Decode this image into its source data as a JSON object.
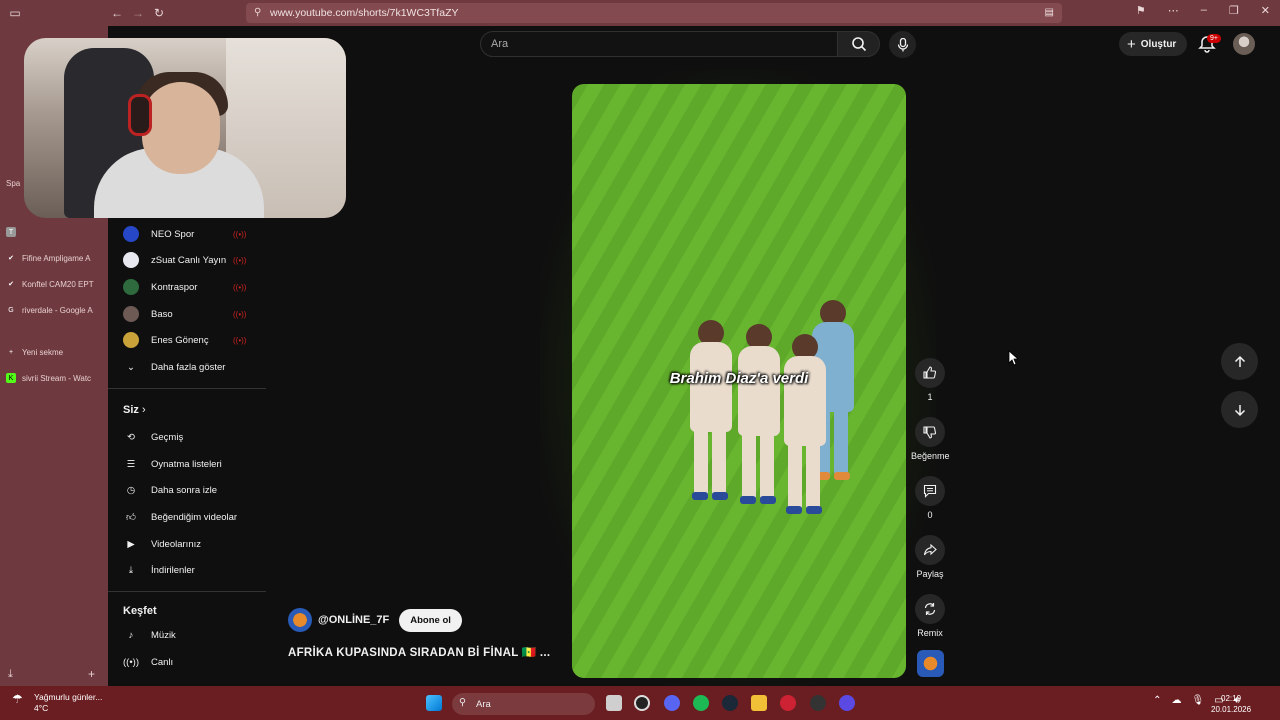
{
  "browser": {
    "url": "www.youtube.com/shorts/7k1WC3TfaZY",
    "tabs": [
      {
        "label": "Fifine Ampligame A",
        "icon": "check-icon"
      },
      {
        "label": "Konftel CAM20 EPT",
        "icon": "check-icon"
      },
      {
        "label": "riverdale - Google A",
        "icon": "google-icon"
      },
      {
        "label": "Yeni sekme",
        "icon": "plus-icon"
      },
      {
        "label": "sivrii Stream - Watc",
        "icon": "kick-icon"
      }
    ],
    "space_label": "Spa"
  },
  "header": {
    "search_placeholder": "Ara",
    "create_label": "Oluştur",
    "notification_count": "9+"
  },
  "sidebar": {
    "subscriptions": [
      {
        "label": "NEO Spor",
        "color": "#2747c9"
      },
      {
        "label": "zSuat Canlı Yayın",
        "color": "#e8e8f0"
      },
      {
        "label": "Kontraspor",
        "color": "#2e6a3e"
      },
      {
        "label": "Baso",
        "color": "#6d5a55"
      },
      {
        "label": "Enes Gönenç",
        "color": "#c9a23a"
      }
    ],
    "show_more": "Daha fazla göster",
    "you_heading": "Siz",
    "you_items": [
      {
        "label": "Geçmiş",
        "icon": "history-icon"
      },
      {
        "label": "Oynatma listeleri",
        "icon": "playlist-icon"
      },
      {
        "label": "Daha sonra izle",
        "icon": "clock-icon"
      },
      {
        "label": "Beğendiğim videolar",
        "icon": "like-icon"
      },
      {
        "label": "Videolarınız",
        "icon": "video-icon"
      },
      {
        "label": "İndirilenler",
        "icon": "download-icon"
      }
    ],
    "explore_heading": "Keşfet",
    "explore_items": [
      {
        "label": "Müzik",
        "icon": "music-icon"
      },
      {
        "label": "Canlı",
        "icon": "live-icon"
      }
    ]
  },
  "short": {
    "caption": "Brahim Diaz'a verdi",
    "channel": "@ONLİNE_7F",
    "subscribe_label": "Abone ol",
    "title": "AFRİKA KUPASINDA SIRADAN Bİ FİNAL 🇸🇳 ...",
    "actions": {
      "like_count": "1",
      "dislike_label": "Beğenme",
      "comment_count": "0",
      "share_label": "Paylaş",
      "remix_label": "Remix"
    }
  },
  "taskbar": {
    "weather_line1": "Yağmurlu günler...",
    "weather_line2": "4°C",
    "search_label": "Ara",
    "time": "02:19",
    "date": "20.01.2026"
  }
}
